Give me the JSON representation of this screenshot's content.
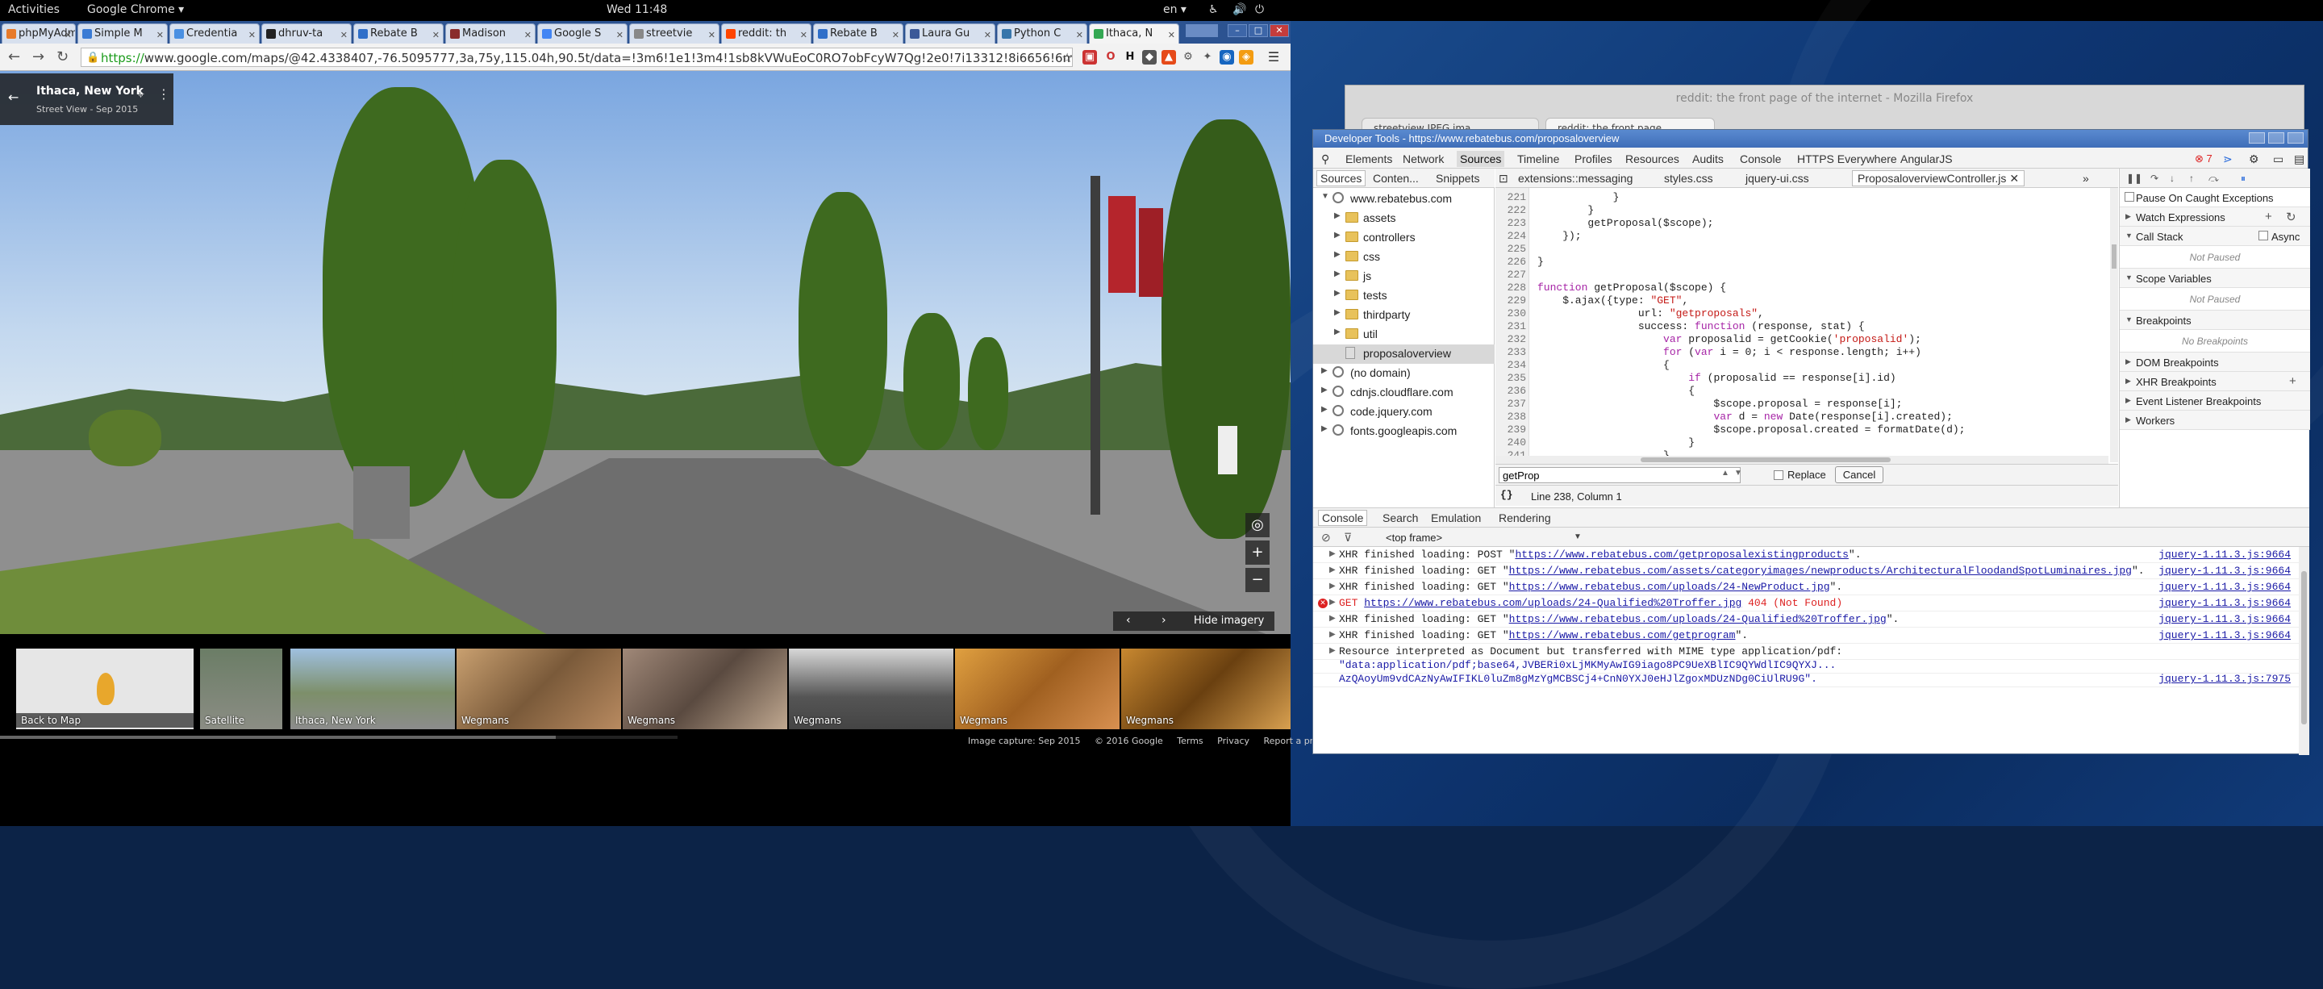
{
  "topbar": {
    "activities": "Activities",
    "app": "Google Chrome ▾",
    "clock": "Wed 11:48",
    "lang": "en ▾"
  },
  "chrome": {
    "tabs": [
      {
        "label": "phpMyAdmin"
      },
      {
        "label": "Simple M"
      },
      {
        "label": "Credentia"
      },
      {
        "label": "dhruv-ta"
      },
      {
        "label": "Rebate B"
      },
      {
        "label": "Madison"
      },
      {
        "label": "Google S"
      },
      {
        "label": "streetvie"
      },
      {
        "label": "reddit: th"
      },
      {
        "label": "Rebate B"
      },
      {
        "label": "Laura Gu"
      },
      {
        "label": "Python C"
      },
      {
        "label": "Ithaca, N"
      }
    ],
    "url_scheme": "https://",
    "url_rest": "www.google.com/maps/@42.4338407,-76.5095777,3a,75y,115.04h,90.5t/data=!3m6!1e1!3m4!1sb8kVWuEoC0RO7obFcyW7Qg!2e0!7i13312!8i6656!6m",
    "ext_badge": "H"
  },
  "streetview": {
    "place": "Ithaca, New York",
    "sub": "Street View - Sep 2015",
    "hide_imagery": "Hide imagery",
    "thumbs": [
      {
        "label": "Back to Map"
      },
      {
        "label": "Satellite"
      },
      {
        "label": "Ithaca, New York"
      },
      {
        "label": "Wegmans"
      },
      {
        "label": "Wegmans"
      },
      {
        "label": "Wegmans"
      },
      {
        "label": "Wegmans"
      },
      {
        "label": "Wegmans"
      }
    ],
    "footer": [
      "Image capture: Sep 2015",
      "© 2016 Google",
      "Terms",
      "Privacy",
      "Report a problem"
    ]
  },
  "firefox": {
    "title": "reddit: the front page of the internet - Mozilla Firefox",
    "tab1": "streetview JPEG ima",
    "tab2": "reddit: the front page"
  },
  "devtools": {
    "title": "Developer Tools - https://www.rebatebus.com/proposaloverview",
    "nav": [
      "Elements",
      "Network",
      "Sources",
      "Timeline",
      "Profiles",
      "Resources",
      "Audits",
      "Console",
      "HTTPS Everywhere",
      "AngularJS"
    ],
    "error_count": "7",
    "nav_tabs": [
      "Sources",
      "Conten...",
      "Snippets"
    ],
    "tree": [
      {
        "label": "www.rebatebus.com",
        "type": "globe",
        "indent": 0
      },
      {
        "label": "assets",
        "type": "folder",
        "indent": 1
      },
      {
        "label": "controllers",
        "type": "folder",
        "indent": 1
      },
      {
        "label": "css",
        "type": "folder",
        "indent": 1
      },
      {
        "label": "js",
        "type": "folder",
        "indent": 1
      },
      {
        "label": "tests",
        "type": "folder",
        "indent": 1
      },
      {
        "label": "thirdparty",
        "type": "folder",
        "indent": 1
      },
      {
        "label": "util",
        "type": "folder",
        "indent": 1
      },
      {
        "label": "proposaloverview",
        "type": "file",
        "indent": 1
      },
      {
        "label": "(no domain)",
        "type": "globe",
        "indent": 0
      },
      {
        "label": "cdnjs.cloudflare.com",
        "type": "globe",
        "indent": 0
      },
      {
        "label": "code.jquery.com",
        "type": "globe",
        "indent": 0
      },
      {
        "label": "fonts.googleapis.com",
        "type": "globe",
        "indent": 0
      }
    ],
    "src_tabs": [
      "extensions::messaging",
      "styles.css",
      "jquery-ui.css",
      "ProposaloverviewController.js"
    ],
    "code": [
      {
        "n": "221",
        "t": "            }"
      },
      {
        "n": "222",
        "t": "        }"
      },
      {
        "n": "223",
        "t": "        getProposal($scope);"
      },
      {
        "n": "224",
        "t": "    });"
      },
      {
        "n": "225",
        "t": ""
      },
      {
        "n": "226",
        "t": "}"
      },
      {
        "n": "227",
        "t": ""
      },
      {
        "n": "228",
        "t": "function getProposal($scope) {"
      },
      {
        "n": "229",
        "t": "    $.ajax({type: \"GET\","
      },
      {
        "n": "230",
        "t": "                url: \"getproposals\","
      },
      {
        "n": "231",
        "t": "                success: function (response, stat) {"
      },
      {
        "n": "232",
        "t": "                    var proposalid = getCookie('proposalid');"
      },
      {
        "n": "233",
        "t": "                    for (var i = 0; i < response.length; i++)"
      },
      {
        "n": "234",
        "t": "                    {"
      },
      {
        "n": "235",
        "t": "                        if (proposalid == response[i].id)"
      },
      {
        "n": "236",
        "t": "                        {"
      },
      {
        "n": "237",
        "t": "                            $scope.proposal = response[i];"
      },
      {
        "n": "238",
        "t": "                            var d = new Date(response[i].created);"
      },
      {
        "n": "239",
        "t": "                            $scope.proposal.created = formatDate(d);"
      },
      {
        "n": "240",
        "t": "                        }"
      },
      {
        "n": "241",
        "t": "                    }"
      }
    ],
    "find_value": "getProp",
    "replace": "Replace",
    "cancel": "Cancel",
    "status_braces": "{}",
    "status_pos": "Line 238, Column 1",
    "debug": {
      "pause": "Pause On Caught Exceptions",
      "sections": [
        "Watch Expressions",
        "Call Stack",
        "Scope Variables",
        "Breakpoints",
        "DOM Breakpoints",
        "XHR Breakpoints",
        "Event Listener Breakpoints",
        "Workers"
      ],
      "async": "Async",
      "not_paused": "Not Paused",
      "no_breakpoints": "No Breakpoints"
    },
    "drawer_tabs": [
      "Console",
      "Search",
      "Emulation",
      "Rendering"
    ],
    "frame": "<top frame>",
    "log": [
      {
        "kind": "xhr",
        "pre": "XHR finished loading: POST \"",
        "url": "https://www.rebatebus.com/getproposalexistingproducts",
        "post": "\".",
        "src": "jquery-1.11.3.js:9664"
      },
      {
        "kind": "xhr",
        "pre": "XHR finished loading: GET \"",
        "url": "https://www.rebatebus.com/assets/categoryimages/newproducts/ArchitecturalFloodandSpotLuminaires.jpg",
        "post": "\".",
        "src": "jquery-1.11.3.js:9664"
      },
      {
        "kind": "xhr",
        "pre": "XHR finished loading: GET \"",
        "url": "https://www.rebatebus.com/uploads/24-NewProduct.jpg",
        "post": "\".",
        "src": "jquery-1.11.3.js:9664"
      },
      {
        "kind": "err",
        "pre": "GET ",
        "url": "https://www.rebatebus.com/uploads/24-Qualified%20Troffer.jpg",
        "post": " 404 (Not Found)",
        "src": "jquery-1.11.3.js:9664"
      },
      {
        "kind": "xhr",
        "pre": "XHR finished loading: GET \"",
        "url": "https://www.rebatebus.com/uploads/24-Qualified%20Troffer.jpg",
        "post": "\".",
        "src": "jquery-1.11.3.js:9664"
      },
      {
        "kind": "xhr",
        "pre": "XHR finished loading: GET \"",
        "url": "https://www.rebatebus.com/getprogram",
        "post": "\".",
        "src": "jquery-1.11.3.js:9664"
      },
      {
        "kind": "info",
        "pre": "Resource interpreted as Document but transferred with MIME type application/pdf:",
        "url": "",
        "post": "",
        "src": ""
      },
      {
        "kind": "cont",
        "pre": "\"data:application/pdf;base64,JVBERi0xLjMKMyAwIG9iago8PC9UeXBlIC9QYWdlIC9QYXJ...",
        "url": "",
        "post": "",
        "src": ""
      },
      {
        "kind": "cont",
        "pre": "AzQAoyUm9vdCAzNyAwIFIKL0luZm8gMzYgMCBSCj4+CnN0YXJ0eHJlZgoxMDUzNDg0CiUlRU9G\".",
        "url": "",
        "post": "",
        "src": "jquery-1.11.3.js:7975"
      }
    ]
  }
}
